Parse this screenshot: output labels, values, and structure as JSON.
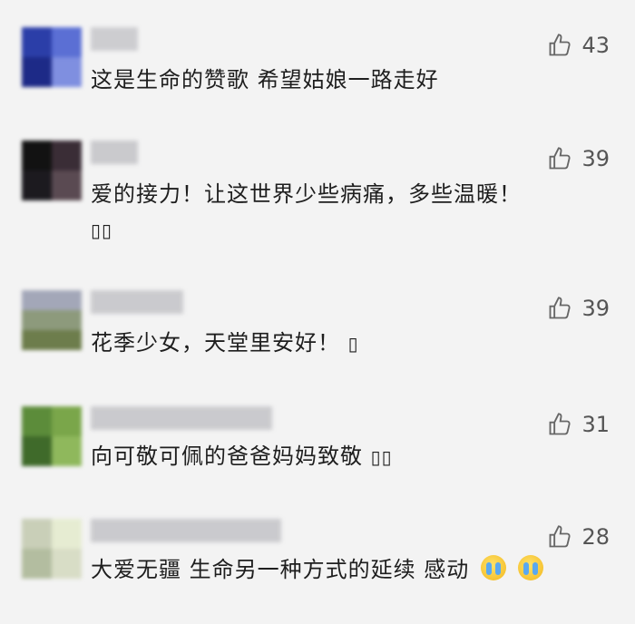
{
  "comments": [
    {
      "text": "这是生命的赞歌 希望姑娘一路走好",
      "likes": "43",
      "avatar_colors": [
        "#2b3ea8",
        "#5b6fd4",
        "#1d2a87",
        "#7f8fe0"
      ]
    },
    {
      "text": "爱的接力！让这世界少些病痛，多些温暖！",
      "extra": "▯▯",
      "likes": "39",
      "avatar_colors": [
        "#121212",
        "#3a2d36",
        "#1c1a1f",
        "#5a4a52"
      ]
    },
    {
      "text": "花季少女，天堂里安好！",
      "extra": "▯",
      "likes": "39",
      "avatar_colors": [
        "#a3a7b8",
        "#8d9a7c",
        "#6d7d4c",
        "#c8ccd8"
      ]
    },
    {
      "text": "向可敬可佩的爸爸妈妈致敬",
      "extra": "▯▯",
      "likes": "31",
      "avatar_colors": [
        "#5c8c3a",
        "#7aa64a",
        "#3f6a2a",
        "#8fb85c"
      ]
    },
    {
      "text": "大爱无疆 生命另一种方式的延续 感动",
      "likes": "28",
      "emoji_count": 2,
      "avatar_colors": [
        "#c9cfb8",
        "#e6ecd2",
        "#b3bda0",
        "#d8ddc6"
      ]
    }
  ],
  "icons": {
    "like": "thumbs-up-icon",
    "emoji": "crying-face-emoji"
  }
}
